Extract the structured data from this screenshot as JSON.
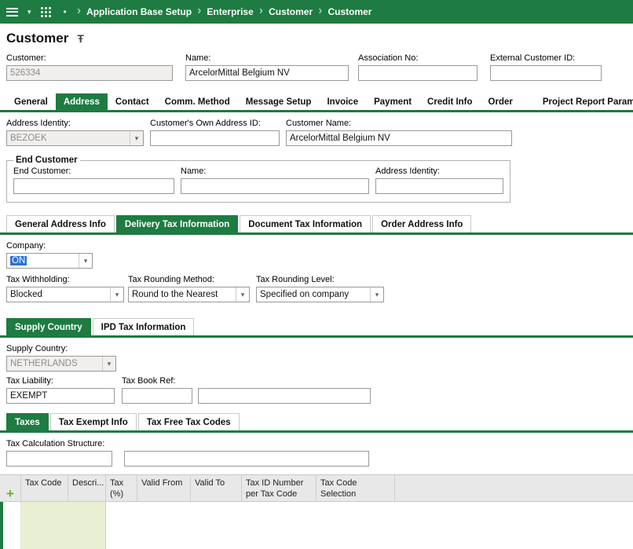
{
  "colors": {
    "accent_green": "#1e7b41",
    "selection_blue": "#2b71d9",
    "new_row_bg": "#e9efd2"
  },
  "icons": {
    "caret": "▾",
    "bullet": "•",
    "chevron": "›",
    "pin": "Ŧ",
    "combo_arrow": "▾",
    "add": "+"
  },
  "topbar": {
    "breadcrumbs": [
      "Application Base Setup",
      "Enterprise",
      "Customer",
      "Customer"
    ]
  },
  "page": {
    "title": "Customer"
  },
  "header_fields": {
    "customer": {
      "label": "Customer:",
      "value": "526334"
    },
    "name": {
      "label": "Name:",
      "value": "ArcelorMittal Belgium NV"
    },
    "association_no": {
      "label": "Association No:",
      "value": ""
    },
    "external_customer_id": {
      "label": "External Customer ID:",
      "value": ""
    }
  },
  "main_tabs": {
    "selected": "Address",
    "items": [
      "General",
      "Address",
      "Contact",
      "Comm. Method",
      "Message Setup",
      "Invoice",
      "Payment",
      "Credit Info",
      "Order",
      "Project Report Parameters"
    ]
  },
  "address": {
    "address_identity": {
      "label": "Address Identity:",
      "value": "BEZOEK"
    },
    "own_address_id": {
      "label": "Customer's Own Address ID:",
      "value": ""
    },
    "customer_name": {
      "label": "Customer Name:",
      "value": "ArcelorMittal Belgium NV"
    },
    "end_customer": {
      "legend": "End Customer",
      "end_customer": {
        "label": "End Customer:",
        "value": ""
      },
      "name": {
        "label": "Name:",
        "value": ""
      },
      "address_identity": {
        "label": "Address Identity:",
        "value": ""
      }
    }
  },
  "address_tabs": {
    "selected": "Delivery Tax Information",
    "items": [
      "General Address Info",
      "Delivery Tax Information",
      "Document Tax Information",
      "Order Address Info"
    ]
  },
  "delivery_tax": {
    "company": {
      "label": "Company:",
      "value": "ON"
    },
    "tax_withholding": {
      "label": "Tax Withholding:",
      "value": "Blocked"
    },
    "tax_rounding_method": {
      "label": "Tax Rounding Method:",
      "value": "Round to the Nearest"
    },
    "tax_rounding_level": {
      "label": "Tax Rounding Level:",
      "value": "Specified on company"
    }
  },
  "supply_tabs": {
    "selected": "Supply Country",
    "items": [
      "Supply Country",
      "IPD Tax Information"
    ]
  },
  "supply": {
    "supply_country": {
      "label": "Supply Country:",
      "value": "NETHERLANDS"
    },
    "tax_liability": {
      "label": "Tax Liability:",
      "value": "EXEMPT"
    },
    "tax_book_ref": {
      "label": "Tax Book Ref:",
      "value1": "",
      "value2": ""
    }
  },
  "taxes_tabs": {
    "selected": "Taxes",
    "items": [
      "Taxes",
      "Tax Exempt Info",
      "Tax Free Tax Codes"
    ]
  },
  "taxes": {
    "tax_calculation_structure": {
      "label": "Tax Calculation Structure:",
      "value1": "",
      "value2": ""
    }
  },
  "grid": {
    "columns": [
      "Tax Code",
      "Descri...",
      "Tax (%)",
      "Valid From",
      "Valid To",
      "Tax ID Number per Tax Code",
      "Tax Code Selection"
    ],
    "rows": []
  }
}
